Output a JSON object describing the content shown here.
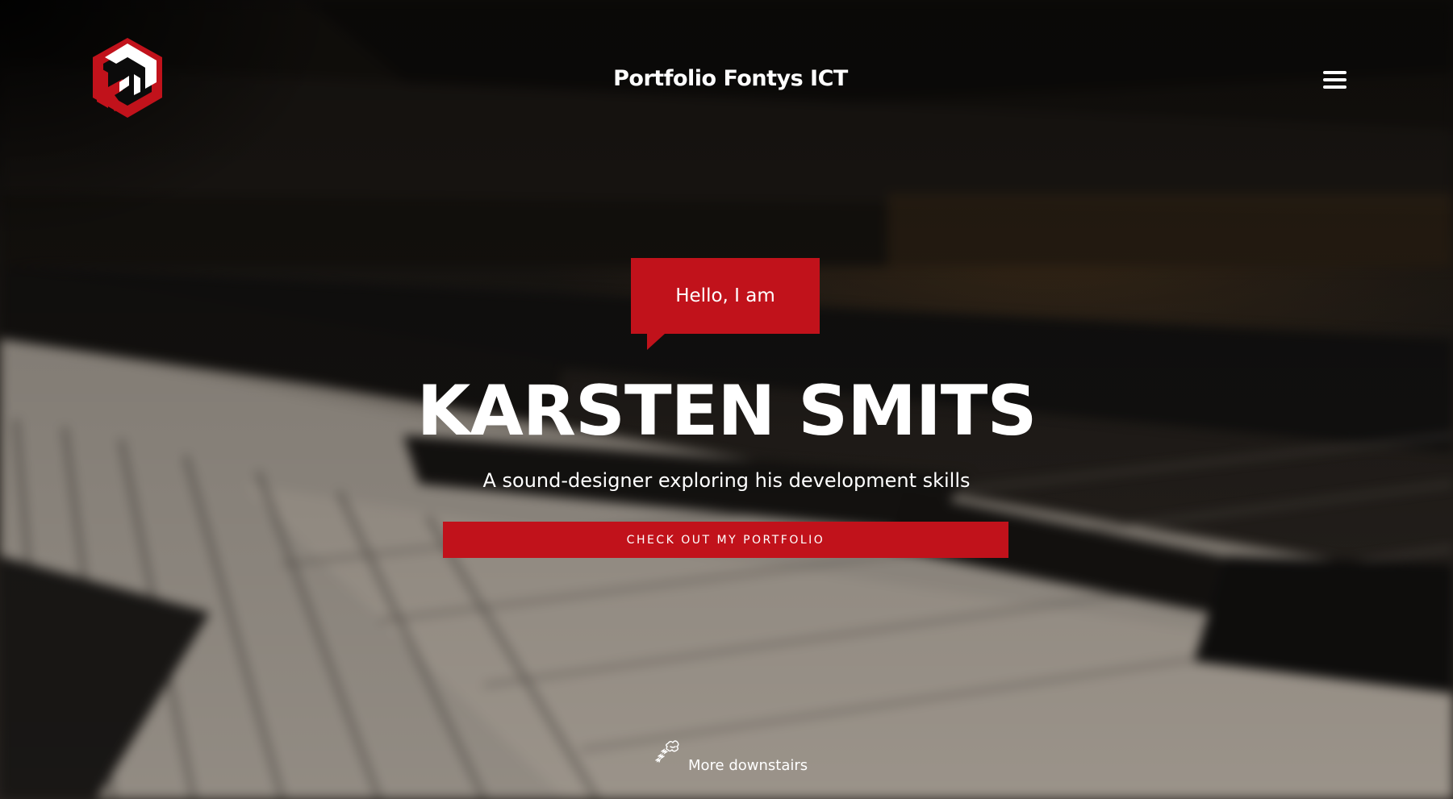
{
  "header": {
    "title": "Portfolio Fontys ICT",
    "logo_icon": "ks-cube-logo-icon",
    "menu_icon": "hamburger-menu-icon"
  },
  "hero": {
    "greeting": "Hello, I am",
    "name": "KARSTEN SMITS",
    "tagline": "A sound-designer exploring his development skills",
    "cta_label": "CHECK OUT MY PORTFOLIO",
    "background_image": "blurred close-up of piano keys",
    "scroll_label": "More downstairs",
    "scroll_icon": "scroll-hint-icon"
  },
  "colors": {
    "accent": "#c1121b",
    "text": "#ffffff"
  }
}
